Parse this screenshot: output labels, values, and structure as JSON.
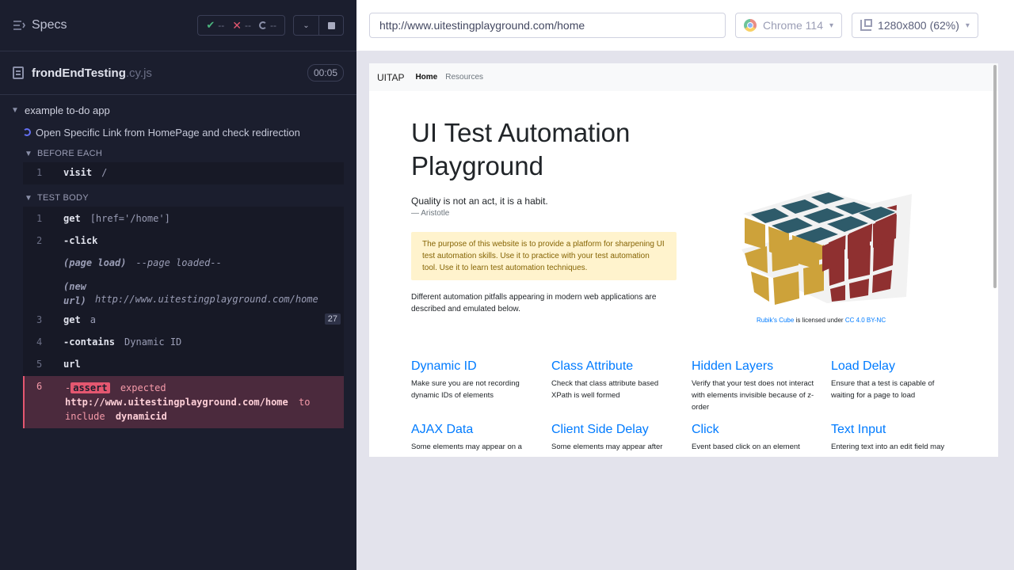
{
  "reporter": {
    "specs_label": "Specs",
    "stats": {
      "passed": "--",
      "failed": "--",
      "pending": "--"
    },
    "spec_file": {
      "name": "frondEndTesting",
      "ext": ".cy.js",
      "duration": "00:05"
    },
    "suite_title": "example to-do app",
    "test_title": "Open Specific Link from HomePage and check redirection",
    "before_each_label": "BEFORE EACH",
    "test_body_label": "TEST BODY",
    "before_each": [
      {
        "num": "1",
        "name": "visit",
        "msg": "/"
      }
    ],
    "commands": [
      {
        "num": "1",
        "name": "get",
        "msg": "[href='/home']"
      },
      {
        "num": "2",
        "name": "-click",
        "msg": ""
      },
      {
        "num": "",
        "name": "(page load)",
        "msg": "--page loaded--"
      },
      {
        "num": "",
        "name": "(new url)",
        "msg": "http://www.uitestingplayground.com/home"
      },
      {
        "num": "3",
        "name": "get",
        "msg": "a",
        "badge": "27"
      },
      {
        "num": "4",
        "name": "-contains",
        "msg": "Dynamic ID"
      },
      {
        "num": "5",
        "name": "url",
        "msg": ""
      }
    ],
    "failed_command": {
      "num": "6",
      "prefix": "-",
      "tag": "assert",
      "word_expected": "expected",
      "value": "http://www.uitestingplayground.com/home",
      "word_to": "to",
      "word_include": "include",
      "target": "dynamicid"
    }
  },
  "aut": {
    "url": "http://www.uitestingplayground.com/home",
    "browser": "Chrome 114",
    "viewport": "1280x800",
    "scale": "(62%)"
  },
  "site": {
    "brand": "UITAP",
    "nav": [
      "Home",
      "Resources"
    ],
    "title": "UI Test Automation Playground",
    "quote": "Quality is not an act, it is a habit.",
    "quote_author": "— Aristotle",
    "purpose": "The purpose of this website is to provide a platform for sharpening UI test automation skills. Use it to practice with your test automation tool. Use it to learn test automation techniques.",
    "pitfalls": "Different automation pitfalls appearing in modern web applications are described and emulated below.",
    "credit": {
      "link1": "Rubik's Cube",
      "middle": " is licensed under ",
      "link2": "CC 4.0 BY-NC"
    },
    "cards": [
      {
        "title": "Dynamic ID",
        "desc": "Make sure you are not recording dynamic IDs of elements"
      },
      {
        "title": "Class Attribute",
        "desc": "Check that class attribute based XPath is well formed"
      },
      {
        "title": "Hidden Layers",
        "desc": "Verify that your test does not interact with elements invisible because of z-order"
      },
      {
        "title": "Load Delay",
        "desc": "Ensure that a test is capable of waiting for a page to load"
      },
      {
        "title": "AJAX Data",
        "desc": "Some elements may appear on a"
      },
      {
        "title": "Client Side Delay",
        "desc": "Some elements may appear after"
      },
      {
        "title": "Click",
        "desc": "Event based click on an element"
      },
      {
        "title": "Text Input",
        "desc": "Entering text into an edit field may"
      }
    ]
  }
}
